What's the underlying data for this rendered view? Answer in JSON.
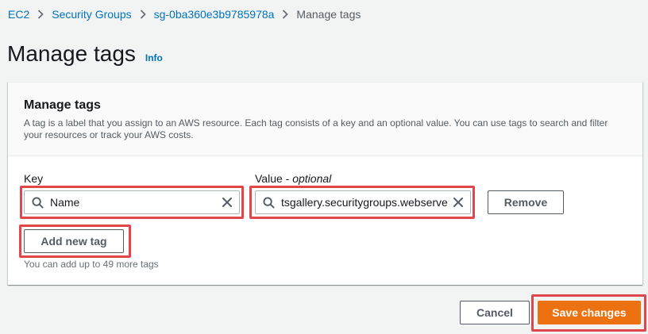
{
  "breadcrumb": {
    "items": [
      "EC2",
      "Security Groups",
      "sg-0ba360e3b9785978a"
    ],
    "current": "Manage tags"
  },
  "page": {
    "title": "Manage tags",
    "info": "Info"
  },
  "panel": {
    "title": "Manage tags",
    "description": "A tag is a label that you assign to an AWS resource. Each tag consists of a key and an optional value. You can use tags to search and filter your resources or track your AWS costs."
  },
  "fields": {
    "key_label": "Key",
    "value_label": "Value - ",
    "value_optional": "optional"
  },
  "tag": {
    "key": "Name",
    "value": "tsgallery.securitygroups.webserver"
  },
  "buttons": {
    "remove": "Remove",
    "add": "Add new tag",
    "cancel": "Cancel",
    "save": "Save changes"
  },
  "hint": "You can add up to 49 more tags",
  "colors": {
    "link": "#0073bb",
    "primary": "#ec7211",
    "highlight": "#e0474d"
  }
}
